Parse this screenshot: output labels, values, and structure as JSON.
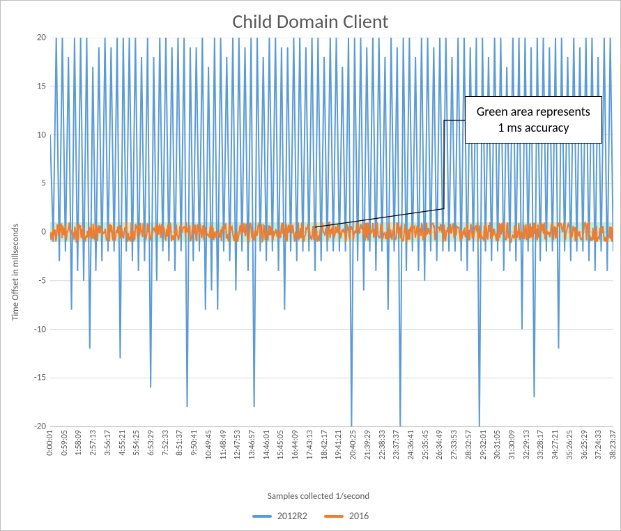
{
  "chart_data": {
    "type": "line",
    "title": "Child Domain Client",
    "xlabel": "Samples collected 1/second",
    "ylabel": "Time Offset in mIllseconds",
    "ylim": [
      -20,
      20
    ],
    "categories": [
      "0:00:01",
      "0:59:05",
      "1:58:09",
      "2:57:13",
      "3:56:17",
      "4:55:21",
      "5:54:25",
      "6:53:29",
      "7:52:33",
      "8:51:37",
      "9:50:41",
      "10:49:45",
      "11:48:49",
      "12:47:53",
      "13:46:57",
      "14:46:01",
      "15:45:05",
      "16:44:09",
      "17:43:13",
      "18:42:17",
      "19:41:21",
      "20:40:25",
      "21:39:29",
      "22:38:33",
      "23:37:37",
      "24:36:41",
      "25:35:45",
      "26:34:49",
      "27:33:53",
      "28:32:57",
      "29:32:01",
      "30:31:05",
      "31:30:09",
      "32:29:13",
      "33:28:17",
      "34:27:21",
      "35:26:25",
      "36:25:29",
      "37:24:33",
      "38:23:37"
    ],
    "series": [
      {
        "name": "2012R2",
        "color": "#5b9bd5",
        "values": [
          10,
          -1,
          20,
          -3,
          20,
          -2,
          18,
          -8,
          20,
          -4,
          20,
          -5,
          20,
          -12,
          17,
          -4,
          19,
          -3,
          20,
          -2,
          19,
          -2,
          20,
          -13,
          20,
          -2,
          20,
          -3,
          20,
          -4,
          18,
          -3,
          20,
          -16,
          18,
          -5,
          20,
          -2,
          20,
          -3,
          19,
          -4,
          20,
          -2,
          20,
          -18,
          19,
          -3,
          19,
          -2,
          20,
          -8,
          17,
          -6,
          20,
          -8,
          20,
          -2,
          18,
          -3,
          20,
          -6,
          20,
          -2,
          19,
          -4,
          20,
          -18,
          20,
          -2,
          18,
          -3,
          20,
          -2,
          20,
          -4,
          19,
          -8,
          19,
          -2,
          20,
          -3,
          20,
          -2,
          19,
          -2,
          20,
          -4,
          20,
          -3,
          18,
          -2,
          20,
          -2,
          20,
          -2,
          17,
          -2,
          20,
          -20,
          20,
          -3,
          20,
          -6,
          19,
          -2,
          20,
          -4,
          20,
          -2,
          18,
          -8,
          20,
          -2,
          19,
          -20,
          20,
          -4,
          20,
          -2,
          18,
          -4,
          20,
          -5,
          20,
          -2,
          19,
          -3,
          20,
          -2,
          20,
          -2,
          18,
          -2,
          20,
          -3,
          20,
          -4,
          19,
          -2,
          20,
          -20,
          20,
          -2,
          18,
          -3,
          20,
          -2,
          20,
          -4,
          17,
          -2,
          20,
          -3,
          20,
          -10,
          20,
          -2,
          19,
          -17,
          20,
          -3,
          20,
          -2,
          19,
          -2,
          20,
          -12,
          20,
          -2,
          18,
          -3,
          20,
          -2,
          19,
          -2,
          20,
          -3,
          20,
          -4,
          18,
          -2,
          20,
          -4,
          20,
          -2
        ]
      },
      {
        "name": "2016",
        "color": "#ed7d31",
        "values_profile": "noise_within_band",
        "approx_range": [
          -1,
          1
        ]
      }
    ],
    "accuracy_band_ms": 1,
    "annotation": "Green area represents 1 ms accuracy",
    "legend_position": "bottom"
  },
  "colors": {
    "series_2012R2": "#5b9bd5",
    "series_2016": "#ed7d31",
    "band": "#b5e2c3"
  }
}
